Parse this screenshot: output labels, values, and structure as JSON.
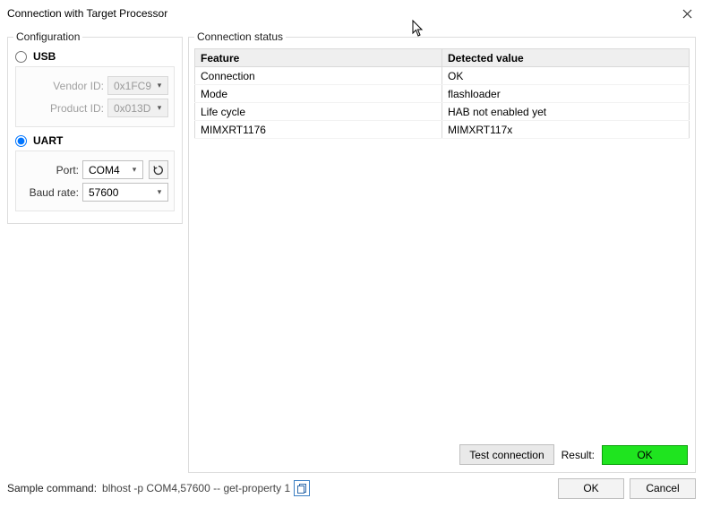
{
  "window": {
    "title": "Connection with Target Processor"
  },
  "config": {
    "legend": "Configuration",
    "usb": {
      "label": "USB",
      "vendor_label": "Vendor ID:",
      "vendor_value": "0x1FC9",
      "product_label": "Product ID:",
      "product_value": "0x013D"
    },
    "uart": {
      "label": "UART",
      "port_label": "Port:",
      "port_value": "COM4",
      "baud_label": "Baud rate:",
      "baud_value": "57600"
    }
  },
  "status": {
    "legend": "Connection status",
    "col_feature": "Feature",
    "col_value": "Detected value",
    "rows": [
      {
        "feature": "Connection",
        "value": "OK"
      },
      {
        "feature": "Mode",
        "value": "flashloader"
      },
      {
        "feature": "Life cycle",
        "value": "HAB not enabled yet"
      },
      {
        "feature": "MIMXRT1176",
        "value": "MIMXRT117x"
      }
    ],
    "test_btn": "Test connection",
    "result_label": "Result:",
    "result_value": "OK"
  },
  "bottom": {
    "sample_label": "Sample command:",
    "sample_cmd": "blhost -p COM4,57600 -- get-property 1",
    "ok": "OK",
    "cancel": "Cancel"
  }
}
